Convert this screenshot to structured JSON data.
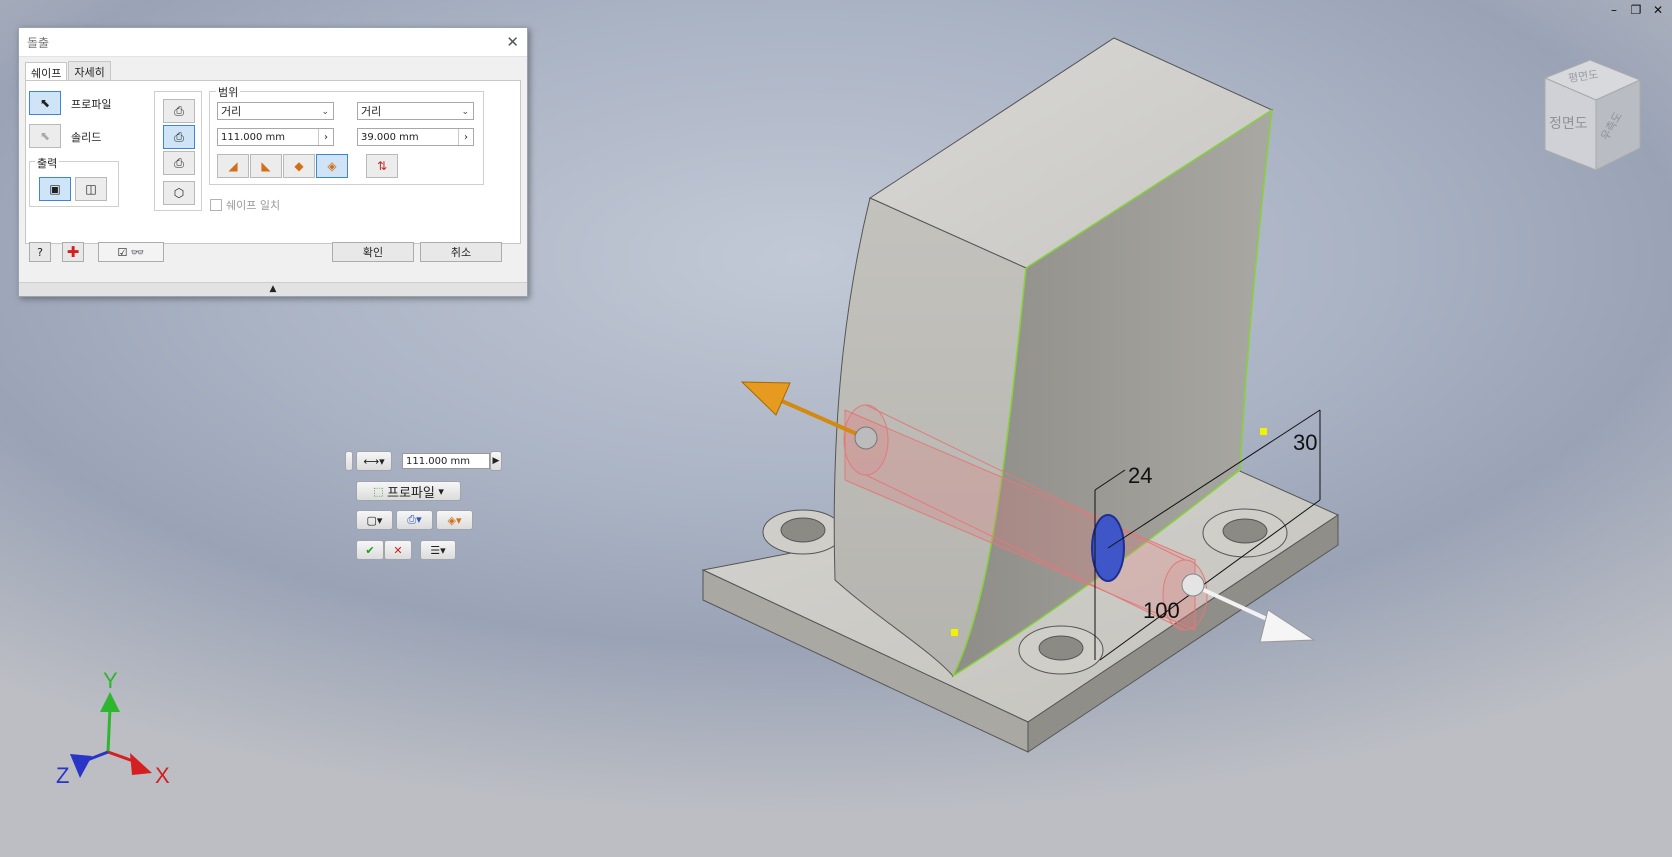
{
  "window_controls": {
    "minimize": "–",
    "restore": "❐",
    "close": "✕"
  },
  "viewcube": {
    "top": "평면도",
    "front": "정면도",
    "right": "우측도"
  },
  "dialog": {
    "title": "돌출",
    "close": "✕",
    "tabs": [
      {
        "label": "쉐이프"
      },
      {
        "label": "자세히"
      }
    ],
    "profile_label": "프로파일",
    "solid_label": "솔리드",
    "output_label": "출력",
    "extents_label": "범위",
    "direction1_type": "거리",
    "direction2_type": "거리",
    "distance1": "111.000 mm",
    "distance2": "39.000 mm",
    "match_shape_label": "쉐이프 일치",
    "ok_label": "확인",
    "cancel_label": "취소",
    "expand_icon": "▲"
  },
  "mini_toolbar": {
    "distance": "111.000 mm",
    "profile_label": "프로파일"
  },
  "dimensions": {
    "d1": "24",
    "d2": "30",
    "d3": "100"
  },
  "triad": {
    "x": "X",
    "y": "Y",
    "z": "Z"
  }
}
